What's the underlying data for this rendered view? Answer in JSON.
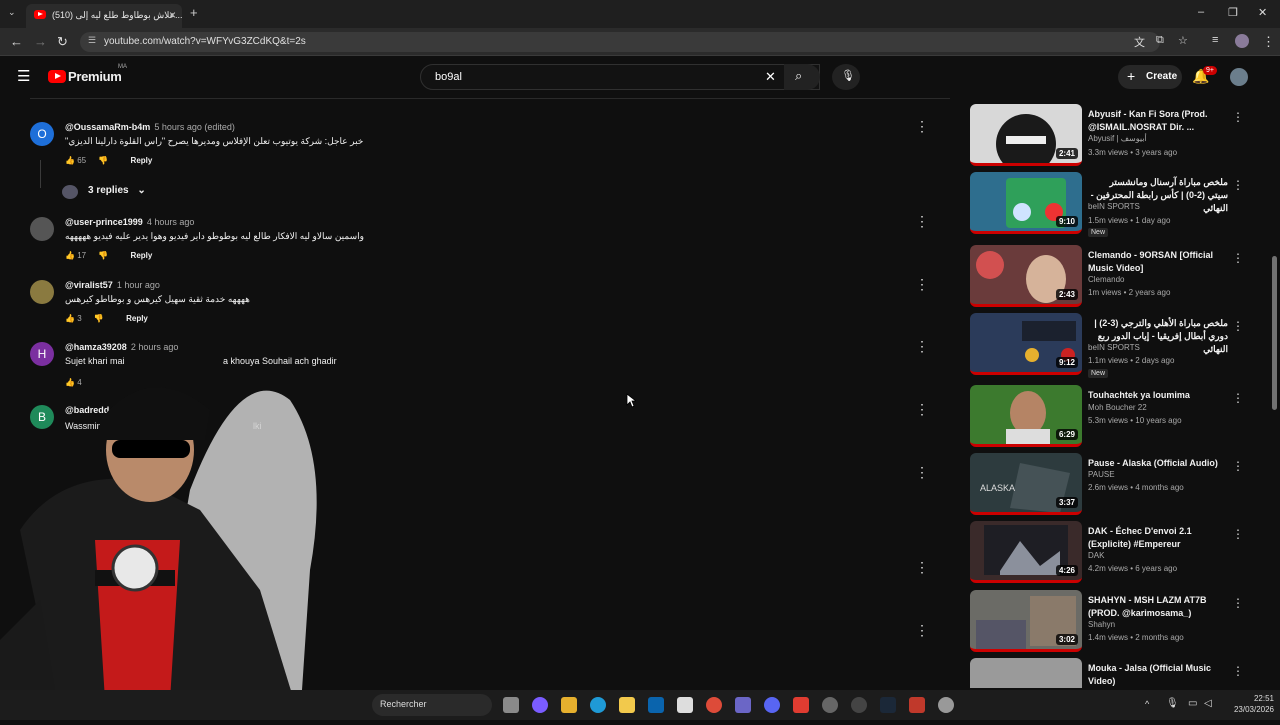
{
  "browser": {
    "tab_title": "(510) علاش بوطاوط طلع ليه إلى...",
    "url": "youtube.com/watch?v=WFYvG3ZCdKQ&t=2s"
  },
  "header": {
    "logo": "Premium",
    "logo_sup": "MA",
    "search_value": "bo9al",
    "create_label": "Create",
    "notif_count": "9+"
  },
  "comments": [
    {
      "avatar_letter": "O",
      "avatar_color": "#1e6fd9",
      "handle": "@OussamaRm-b4m",
      "time": "5 hours ago (edited)",
      "text": "خبر عاجل: شركة يوتيوب تعلن الإفلاس ومديرها يصرح \"راس القلوة دارلينا الديزي\"",
      "likes": "65",
      "reply": "Reply"
    },
    {
      "avatar_letter": "",
      "avatar_color": "#555555",
      "handle": "@user-prince1999",
      "time": "4 hours ago",
      "text": "واسمين سالاو ليه الافكار طالع ليه بوطوطو داير فيديو وهوا يدير عليه فيديو هههههه",
      "likes": "17",
      "reply": "Reply"
    },
    {
      "avatar_letter": "",
      "avatar_color": "#8a7a40",
      "handle": "@viralist57",
      "time": "1 hour ago",
      "text": "ههههه خدمة ثقية سهيل كيرهس و بوطاطو كيرهس",
      "likes": "3",
      "reply": "Reply"
    },
    {
      "avatar_letter": "H",
      "avatar_color": "#7b2fa0",
      "handle": "@hamza39208",
      "time": "2 hours ago",
      "text": "Sujet khari mai",
      "text2": "a khouya Souhail ach ghadir",
      "likes": "4",
      "reply": "Reply"
    },
    {
      "avatar_letter": "B",
      "avatar_color": "#1f8a5a",
      "handle": "@badredd",
      "time": "",
      "text": "Wassmin",
      "text2": "lki",
      "likes": "",
      "reply": ""
    }
  ],
  "replies_toggle": "3 replies",
  "sidebar": [
    {
      "title": "Abyusif - Kan Fi Sora (Prod. @ISMAIL.NOSRAT Dir. ...",
      "channel": "Abyusif | أبيوسف",
      "stats": "3.3m views • 3 years ago",
      "duration": "2:41",
      "new": "",
      "thumb_color": "#d8d8d8"
    },
    {
      "title": "ملخص مباراة آرسنال ومانشستر سيتي (2-0) | كأس رابطة المحترفين - النهائي",
      "channel": "beIN SPORTS",
      "stats": "1.5m views • 1 day ago",
      "duration": "9:10",
      "new": "New",
      "thumb_color": "#2e6e8e"
    },
    {
      "title": "Clemando - 9ORSAN [Official Music Video]",
      "channel": "Clemando",
      "stats": "1m views • 2 years ago",
      "duration": "2:43",
      "new": "",
      "thumb_color": "#6a3b3b"
    },
    {
      "title": "ملخص مباراة الأهلي والترجي (3-2) | دوري أبطال إفريقيا - إياب الدور ربع النهائي",
      "channel": "beIN SPORTS",
      "stats": "1.1m views • 2 days ago",
      "duration": "9:12",
      "new": "New",
      "thumb_color": "#2b3b5a"
    },
    {
      "title": "Touhachtek ya loumima",
      "channel": "Moh Boucher 22",
      "stats": "5.3m views • 10 years ago",
      "duration": "6:29",
      "new": "",
      "thumb_color": "#3c7a2e"
    },
    {
      "title": "Pause - Alaska (Official Audio)",
      "channel": "PAUSE",
      "stats": "2.6m views • 4 months ago",
      "duration": "3:37",
      "new": "",
      "thumb_color": "#2d3b3e"
    },
    {
      "title": "DAK - Échec D'envoi 2.1 (Explicite) #Empereur",
      "channel": "DAK",
      "stats": "4.2m views • 6 years ago",
      "duration": "4:26",
      "new": "",
      "thumb_color": "#3a2a2a"
    },
    {
      "title": "SHAHYN - MSH LAZM AT7B (PROD. @karimosama_)",
      "channel": "Shahyn",
      "stats": "1.4m views • 2 months ago",
      "duration": "3:02",
      "new": "",
      "thumb_color": "#6b6b66"
    },
    {
      "title": "Mouka - Jalsa (Official Music Video)",
      "channel": "",
      "stats": "",
      "duration": "",
      "new": "",
      "thumb_color": "#9a9a9a"
    }
  ],
  "taskbar": {
    "search_label": "Rechercher",
    "time": "22:51",
    "date": "23/03/2026"
  }
}
